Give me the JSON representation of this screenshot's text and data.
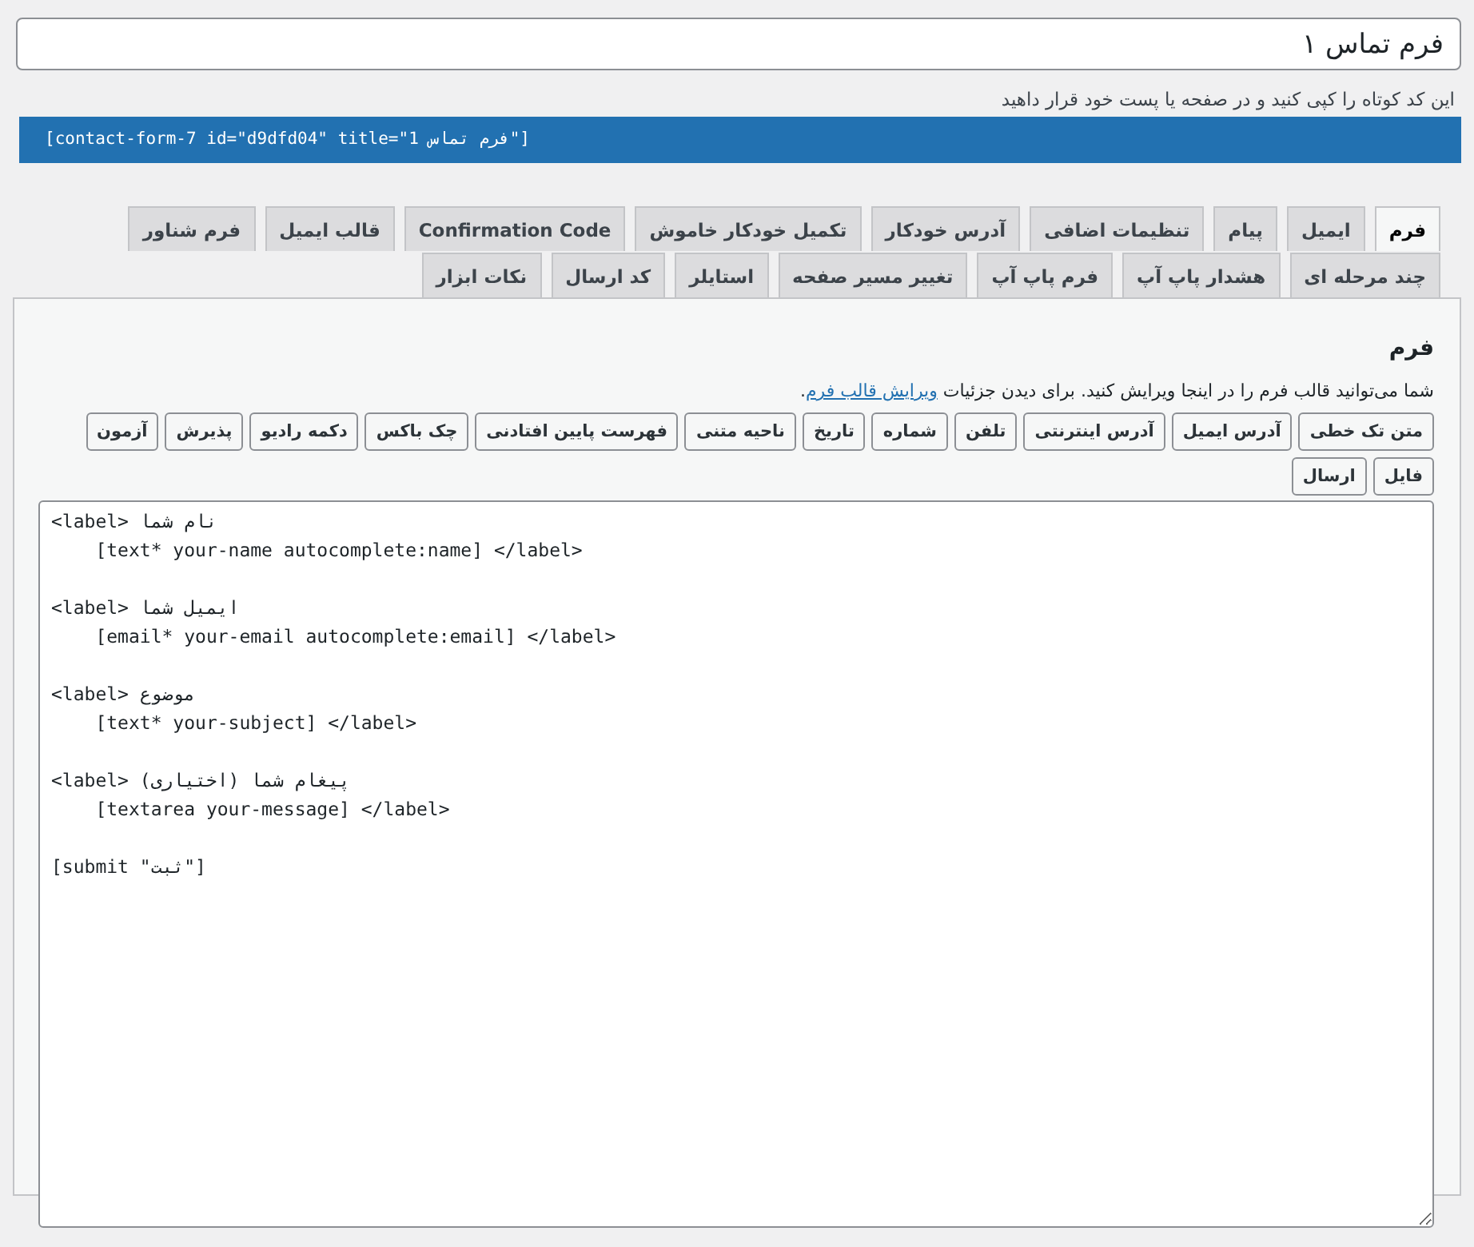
{
  "title_field": {
    "value": "فرم تماس ۱"
  },
  "shortcode_help": "این کد کوتاه را کپی کنید و در صفحه یا پست خود قرار داهید",
  "shortcode": "[contact-form-7 id=\"d9dfd04\" title=\"فرم تماس 1\"]",
  "tabs": [
    {
      "label": "فرم",
      "selected": true
    },
    {
      "label": "ایمیل",
      "selected": false
    },
    {
      "label": "پیام",
      "selected": false
    },
    {
      "label": "تنظیمات اضافی",
      "selected": false
    },
    {
      "label": "آدرس خودکار",
      "selected": false
    },
    {
      "label": "تکمیل خودکار خاموش",
      "selected": false
    },
    {
      "label": "Confirmation Code",
      "selected": false
    },
    {
      "label": "قالب ایمیل",
      "selected": false
    },
    {
      "label": "فرم شناور",
      "selected": false
    },
    {
      "label": "چند مرحله ای",
      "selected": false
    },
    {
      "label": "هشدار پاپ آپ",
      "selected": false
    },
    {
      "label": "فرم پاپ آپ",
      "selected": false
    },
    {
      "label": "تغییر مسیر صفحه",
      "selected": false
    },
    {
      "label": "استایلر",
      "selected": false
    },
    {
      "label": "کد ارسال",
      "selected": false
    },
    {
      "label": "نکات ابزار",
      "selected": false
    }
  ],
  "panel": {
    "heading": "فرم",
    "description": "شما می‌توانید قالب فرم را در اینجا ویرایش کنید. برای دیدن جزئیات ",
    "link": "ویرایش قالب فرم",
    "description_end": ".",
    "tag_buttons": [
      "متن تک خطی",
      "آدرس ایمیل",
      "آدرس اینترنتی",
      "تلفن",
      "شماره",
      "تاریخ",
      "ناحیه متنی",
      "فهرست پایین افتادنی",
      "چک باکس",
      "دکمه رادیو",
      "پذیرش",
      "آزمون",
      "فایل",
      "ارسال"
    ],
    "editor": {
      "value": "<label> نام شما\n    [text* your-name autocomplete:name] </label>\n\n<label> ایمیل شما\n    [email* your-email autocomplete:email] </label>\n\n<label> موضوع\n    [text* your-subject] </label>\n\n<label> پیغام شما (اختیاری)\n    [textarea your-message] </label>\n\n[submit \"ثبت\"]"
    }
  }
}
